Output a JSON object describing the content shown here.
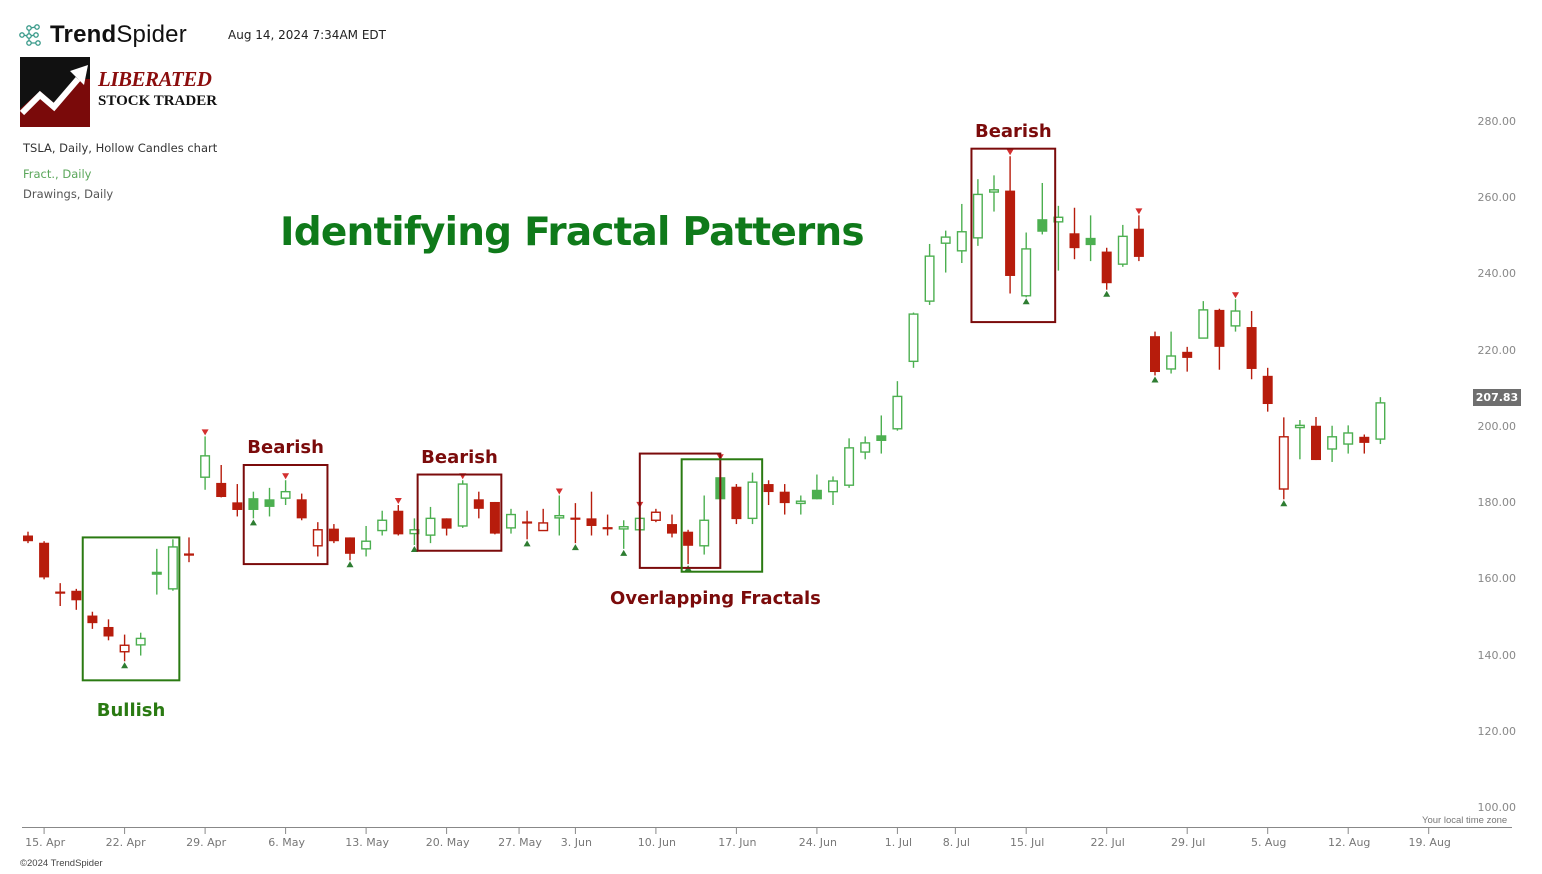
{
  "header": {
    "brand": {
      "strong": "Trend",
      "light": "Spider",
      "icon": "spider-nodes-icon"
    },
    "timestamp": "Aug 14, 2024 7:34AM EDT",
    "logo": {
      "top": "LIBERATED",
      "bottom": "STOCK TRADER",
      "icon": "rising-arrow-logo-icon"
    },
    "symbol_line": "TSLA, Daily, Hollow Candles chart",
    "indicator_line": "Fract., Daily",
    "drawings_line": "Drawings, Daily"
  },
  "footer": {
    "copyright": "©2024 TrendSpider",
    "timezone_note": "Your local time zone"
  },
  "colors": {
    "up": "#4caf50",
    "down": "#b71c0c",
    "bull_fractal": "#2e7d32",
    "bear_fractal": "#d32f2f",
    "bearish_box": "#7b0b0b",
    "bullish_box": "#2a7a12",
    "title": "#0f7a1a",
    "last_price_bg": "#6e6e6e"
  },
  "chart_data": {
    "type": "candlestick",
    "title": "Identifying Fractal Patterns",
    "symbol": "TSLA",
    "interval": "Daily",
    "style": "Hollow Candles",
    "ylim": [
      100,
      280
    ],
    "yticks": [
      "100.00",
      "120.00",
      "140.00",
      "160.00",
      "180.00",
      "200.00",
      "220.00",
      "240.00",
      "260.00",
      "280.00"
    ],
    "xticks": [
      "15. Apr",
      "22. Apr",
      "29. Apr",
      "6. May",
      "13. May",
      "20. May",
      "27. May",
      "3. Jun",
      "10. Jun",
      "17. Jun",
      "24. Jun",
      "1. Jul",
      "8. Jul",
      "15. Jul",
      "22. Jul",
      "29. Jul",
      "5. Aug",
      "12. Aug",
      "19. Aug"
    ],
    "xtick_index": [
      1,
      6,
      11,
      16,
      21,
      26,
      30.5,
      34,
      39,
      44,
      49,
      54,
      57.6,
      62,
      67,
      72,
      77,
      82,
      87
    ],
    "last_price": "207.83",
    "candles": [
      {
        "d": "12 Apr",
        "o": 171.5,
        "h": 172.5,
        "l": 169.5,
        "c": 170.0
      },
      {
        "d": "15 Apr",
        "o": 169.6,
        "h": 170.0,
        "l": 160.0,
        "c": 160.5
      },
      {
        "d": "16 Apr",
        "o": 156.8,
        "h": 159.0,
        "l": 153.0,
        "c": 156.4
      },
      {
        "d": "17 Apr",
        "o": 157.0,
        "h": 157.5,
        "l": 152.0,
        "c": 154.5
      },
      {
        "d": "18 Apr",
        "o": 150.5,
        "h": 151.5,
        "l": 147.0,
        "c": 148.5
      },
      {
        "d": "19 Apr",
        "o": 147.5,
        "h": 149.5,
        "l": 144.0,
        "c": 145.0
      },
      {
        "d": "22 Apr",
        "o": 141.0,
        "h": 145.5,
        "l": 138.5,
        "c": 142.7,
        "bull": true
      },
      {
        "d": "23 Apr",
        "o": 142.8,
        "h": 146.0,
        "l": 140.0,
        "c": 144.5
      },
      {
        "d": "24 Apr",
        "o": 162.0,
        "h": 168.0,
        "l": 156.0,
        "c": 161.2
      },
      {
        "d": "25 Apr",
        "o": 157.5,
        "h": 170.5,
        "l": 157.0,
        "c": 168.5
      },
      {
        "d": "26 Apr",
        "o": 166.8,
        "h": 171.0,
        "l": 164.5,
        "c": 166.2
      },
      {
        "d": "29 Apr",
        "o": 186.8,
        "h": 197.5,
        "l": 183.5,
        "c": 192.4,
        "bear": true
      },
      {
        "d": "30 Apr",
        "o": 185.3,
        "h": 190.0,
        "l": 181.5,
        "c": 181.6
      },
      {
        "d": "1 May",
        "o": 180.2,
        "h": 185.0,
        "l": 176.5,
        "c": 178.2
      },
      {
        "d": "2 May",
        "o": 181.3,
        "h": 183.0,
        "l": 176.0,
        "c": 178.2,
        "bull": true,
        "fill": "up"
      },
      {
        "d": "3 May",
        "o": 181.0,
        "h": 184.0,
        "l": 176.5,
        "c": 179.0,
        "fill": "up"
      },
      {
        "d": "6 May",
        "o": 181.3,
        "h": 186.0,
        "l": 179.5,
        "c": 183.0,
        "bear": true
      },
      {
        "d": "7 May",
        "o": 181.0,
        "h": 182.5,
        "l": 175.5,
        "c": 176.0
      },
      {
        "d": "8 May",
        "o": 168.8,
        "h": 175.0,
        "l": 166.0,
        "c": 173.0,
        "hollowdown": true
      },
      {
        "d": "9 May",
        "o": 173.3,
        "h": 174.5,
        "l": 169.5,
        "c": 170.0
      },
      {
        "d": "10 May",
        "o": 171.0,
        "h": 171.0,
        "l": 165.0,
        "c": 166.7,
        "bull": true
      },
      {
        "d": "13 May",
        "o": 168.0,
        "h": 174.0,
        "l": 166.0,
        "c": 170.0
      },
      {
        "d": "14 May",
        "o": 172.8,
        "h": 178.0,
        "l": 171.5,
        "c": 175.5
      },
      {
        "d": "15 May",
        "o": 178.0,
        "h": 179.5,
        "l": 171.5,
        "c": 171.8,
        "bear": true
      },
      {
        "d": "16 May",
        "o": 172.0,
        "h": 176.0,
        "l": 169.0,
        "c": 173.0,
        "bull": true
      },
      {
        "d": "17 May",
        "o": 171.6,
        "h": 179.0,
        "l": 169.5,
        "c": 176.0
      },
      {
        "d": "20 May",
        "o": 176.0,
        "h": 176.0,
        "l": 171.5,
        "c": 173.3
      },
      {
        "d": "21 May",
        "o": 174.0,
        "h": 186.0,
        "l": 173.5,
        "c": 185.0,
        "bear": true
      },
      {
        "d": "22 May",
        "o": 181.0,
        "h": 183.0,
        "l": 176.0,
        "c": 178.5
      },
      {
        "d": "23 May",
        "o": 180.3,
        "h": 180.3,
        "l": 171.8,
        "c": 172.0
      },
      {
        "d": "24 May",
        "o": 173.5,
        "h": 178.5,
        "l": 172.0,
        "c": 177.0
      },
      {
        "d": "28 May",
        "o": 175.2,
        "h": 178.0,
        "l": 170.5,
        "c": 174.8,
        "bull": true
      },
      {
        "d": "29 May",
        "o": 172.8,
        "h": 178.5,
        "l": 172.8,
        "c": 174.8,
        "hollowdown": true
      },
      {
        "d": "30 May",
        "o": 176.3,
        "h": 182.0,
        "l": 171.5,
        "c": 176.7,
        "bear": true
      },
      {
        "d": "31 May",
        "o": 176.2,
        "h": 180.0,
        "l": 169.5,
        "c": 175.8,
        "bull": true
      },
      {
        "d": "3 Jun",
        "o": 176.0,
        "h": 183.0,
        "l": 171.5,
        "c": 174.0
      },
      {
        "d": "4 Jun",
        "o": 173.7,
        "h": 177.0,
        "l": 171.5,
        "c": 173.4
      },
      {
        "d": "5 Jun",
        "o": 173.4,
        "h": 175.5,
        "l": 168.0,
        "c": 173.8,
        "bull": true
      },
      {
        "d": "6 Jun",
        "o": 173.0,
        "h": 178.5,
        "l": 170.0,
        "c": 176.0,
        "bear": true
      },
      {
        "d": "7 Jun",
        "o": 175.5,
        "h": 178.5,
        "l": 175.0,
        "c": 177.6,
        "hollowdown": true
      },
      {
        "d": "10 Jun",
        "o": 174.5,
        "h": 177.0,
        "l": 171.0,
        "c": 172.0
      },
      {
        "d": "11 Jun",
        "o": 172.5,
        "h": 173.0,
        "l": 164.0,
        "c": 168.8,
        "bull": true
      },
      {
        "d": "12 Jun",
        "o": 168.8,
        "h": 182.0,
        "l": 166.5,
        "c": 175.5
      },
      {
        "d": "13 Jun",
        "o": 186.8,
        "h": 191.0,
        "l": 179.0,
        "c": 181.0,
        "bear": true,
        "fill": "up"
      },
      {
        "d": "14 Jun",
        "o": 184.3,
        "h": 185.0,
        "l": 174.5,
        "c": 175.8
      },
      {
        "d": "17 Jun",
        "o": 176.0,
        "h": 188.0,
        "l": 174.5,
        "c": 185.5
      },
      {
        "d": "18 Jun",
        "o": 185.0,
        "h": 186.0,
        "l": 179.5,
        "c": 182.9
      },
      {
        "d": "20 Jun",
        "o": 183.0,
        "h": 185.0,
        "l": 177.0,
        "c": 180.0
      },
      {
        "d": "21 Jun",
        "o": 180.0,
        "h": 182.0,
        "l": 177.0,
        "c": 180.5
      },
      {
        "d": "24 Jun",
        "o": 183.5,
        "h": 187.5,
        "l": 181.0,
        "c": 181.0
      },
      {
        "d": "25 Jun",
        "o": 183.0,
        "h": 187.0,
        "l": 179.5,
        "c": 185.8
      },
      {
        "d": "26 Jun",
        "o": 184.7,
        "h": 197.0,
        "l": 184.0,
        "c": 194.5
      },
      {
        "d": "27 Jun",
        "o": 193.4,
        "h": 197.5,
        "l": 191.5,
        "c": 195.8
      },
      {
        "d": "28 Jun",
        "o": 197.8,
        "h": 203.0,
        "l": 193.0,
        "c": 196.3,
        "fill": "up"
      },
      {
        "d": "1 Jul",
        "o": 199.5,
        "h": 212.0,
        "l": 199.0,
        "c": 208.0
      },
      {
        "d": "2 Jul",
        "o": 217.2,
        "h": 230.0,
        "l": 215.5,
        "c": 229.6
      },
      {
        "d": "3 Jul",
        "o": 233.0,
        "h": 248.0,
        "l": 232.0,
        "c": 244.8
      },
      {
        "d": "5 Jul",
        "o": 248.2,
        "h": 251.5,
        "l": 240.5,
        "c": 249.8
      },
      {
        "d": "8 Jul",
        "o": 246.2,
        "h": 258.5,
        "l": 243.0,
        "c": 251.2
      },
      {
        "d": "9 Jul",
        "o": 249.6,
        "h": 265.0,
        "l": 247.5,
        "c": 261.0
      },
      {
        "d": "10 Jul",
        "o": 261.7,
        "h": 266.0,
        "l": 256.5,
        "c": 262.2
      },
      {
        "d": "11 Jul",
        "o": 262.0,
        "h": 271.0,
        "l": 235.0,
        "c": 239.6,
        "bear": true
      },
      {
        "d": "12 Jul",
        "o": 234.4,
        "h": 251.0,
        "l": 234.0,
        "c": 246.7,
        "bull": true
      },
      {
        "d": "15 Jul",
        "o": 254.5,
        "h": 264.0,
        "l": 250.5,
        "c": 251.2,
        "fill": "up"
      },
      {
        "d": "16 Jul",
        "o": 253.8,
        "h": 258.0,
        "l": 241.0,
        "c": 255.0
      },
      {
        "d": "17 Jul",
        "o": 250.8,
        "h": 257.5,
        "l": 244.0,
        "c": 246.9
      },
      {
        "d": "18 Jul",
        "o": 249.6,
        "h": 255.5,
        "l": 243.5,
        "c": 247.7,
        "fill": "up"
      },
      {
        "d": "19 Jul",
        "o": 246.0,
        "h": 247.0,
        "l": 236.0,
        "c": 237.7,
        "bull": true
      },
      {
        "d": "22 Jul",
        "o": 242.7,
        "h": 253.0,
        "l": 242.0,
        "c": 250.0
      },
      {
        "d": "23 Jul",
        "o": 252.0,
        "h": 255.5,
        "l": 243.5,
        "c": 244.6,
        "bear": true
      },
      {
        "d": "24 Jul",
        "o": 223.8,
        "h": 225.0,
        "l": 213.5,
        "c": 214.4,
        "bull": true
      },
      {
        "d": "25 Jul",
        "o": 215.2,
        "h": 225.0,
        "l": 214.0,
        "c": 218.6
      },
      {
        "d": "26 Jul",
        "o": 219.7,
        "h": 221.0,
        "l": 214.5,
        "c": 218.1
      },
      {
        "d": "29 Jul",
        "o": 223.3,
        "h": 233.0,
        "l": 223.3,
        "c": 230.7
      },
      {
        "d": "30 Jul",
        "o": 230.7,
        "h": 231.0,
        "l": 215.0,
        "c": 221.0
      },
      {
        "d": "31 Jul",
        "o": 226.5,
        "h": 233.5,
        "l": 225.0,
        "c": 230.4,
        "bear": true
      },
      {
        "d": "1 Aug",
        "o": 226.2,
        "h": 230.4,
        "l": 212.5,
        "c": 215.2
      },
      {
        "d": "2 Aug",
        "o": 213.4,
        "h": 215.5,
        "l": 204.0,
        "c": 206.0
      },
      {
        "d": "5 Aug",
        "o": 183.7,
        "h": 202.5,
        "l": 181.0,
        "c": 197.4,
        "bull": true,
        "hollowdown": true
      },
      {
        "d": "6 Aug",
        "o": 200.1,
        "h": 201.8,
        "l": 191.5,
        "c": 200.4
      },
      {
        "d": "7 Aug",
        "o": 200.3,
        "h": 202.6,
        "l": 191.3,
        "c": 191.3
      },
      {
        "d": "8 Aug",
        "o": 194.2,
        "h": 200.3,
        "l": 190.8,
        "c": 197.4
      },
      {
        "d": "9 Aug",
        "o": 195.5,
        "h": 200.4,
        "l": 193.0,
        "c": 198.4
      },
      {
        "d": "12 Aug",
        "o": 197.4,
        "h": 198.0,
        "l": 193.0,
        "c": 195.8
      },
      {
        "d": "13 Aug",
        "o": 196.8,
        "h": 207.8,
        "l": 195.5,
        "c": 206.3
      }
    ]
  },
  "annotations": [
    {
      "label": "Bullish",
      "type": "bullish",
      "x_from": 3.4,
      "x_to": 9.4,
      "y_top": 171,
      "y_bottom": 133.5,
      "label_pos": "below"
    },
    {
      "label": "Bearish",
      "type": "bearish",
      "x_from": 13.4,
      "x_to": 18.6,
      "y_top": 190,
      "y_bottom": 164,
      "label_pos": "above"
    },
    {
      "label": "Bearish",
      "type": "bearish",
      "x_from": 24.2,
      "x_to": 29.4,
      "y_top": 187.5,
      "y_bottom": 167.5,
      "label_pos": "above"
    },
    {
      "label": "Overlapping Fractals",
      "type": "bearish",
      "x_from": 38.0,
      "x_to": 43.0,
      "y_top": 193,
      "y_bottom": 163,
      "label_pos": "below",
      "label_center": 42.7
    },
    {
      "label": "",
      "type": "bullish",
      "x_from": 40.6,
      "x_to": 45.6,
      "y_top": 191.5,
      "y_bottom": 162
    },
    {
      "label": "Bearish",
      "type": "bearish",
      "x_from": 58.6,
      "x_to": 63.8,
      "y_top": 273,
      "y_bottom": 227.5,
      "label_pos": "above"
    }
  ]
}
